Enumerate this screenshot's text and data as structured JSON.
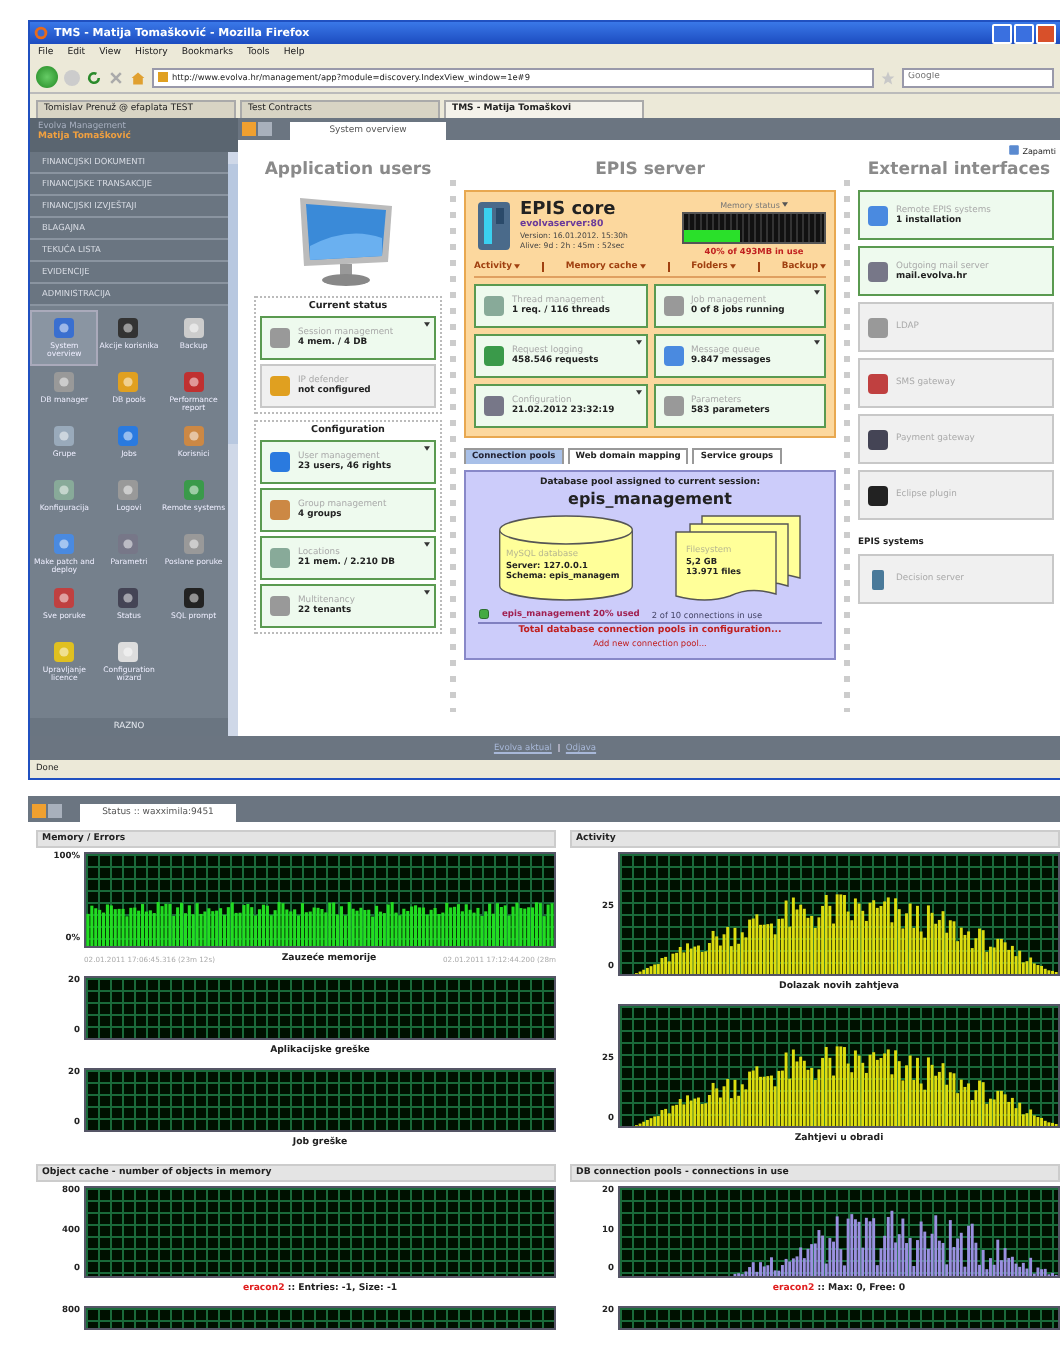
{
  "browser": {
    "title": "TMS - Matija Tomašković - Mozilla Firefox",
    "menu": [
      "File",
      "Edit",
      "View",
      "History",
      "Bookmarks",
      "Tools",
      "Help"
    ],
    "url": "http://www.evolva.hr/management/app?module=discovery.IndexView_window=1e#9",
    "search": {
      "placeholder": "Google"
    },
    "tabs": [
      {
        "label": "Tomislav Prenuž @ efaplata TEST",
        "selected": false
      },
      {
        "label": "Test Contracts",
        "selected": false
      },
      {
        "label": "TMS - Matija Tomaškovi",
        "selected": true
      }
    ],
    "status": "Done"
  },
  "app": {
    "sidebar": {
      "title": "Evolva Management",
      "user": "Matija Tomašković",
      "menu": [
        "FINANCIJSKI DOKUMENTI",
        "FINANCIJSKE TRANSAKCIJE",
        "FINANCIJSKI IZVJEŠTAJI",
        "BLAGAJNA",
        "TEKUĆA LISTA",
        "EVIDENCIJE",
        "ADMINISTRACIJA"
      ],
      "tools": [
        {
          "label": "System overview",
          "selected": true
        },
        {
          "label": "Akcije korisnika",
          "selected": false
        },
        {
          "label": "Backup",
          "selected": false
        },
        {
          "label": "DB manager",
          "selected": false
        },
        {
          "label": "DB pools",
          "selected": false
        },
        {
          "label": "Performance report",
          "selected": false
        },
        {
          "label": "Grupe",
          "selected": false
        },
        {
          "label": "Jobs",
          "selected": false
        },
        {
          "label": "Korisnici",
          "selected": false
        },
        {
          "label": "Konfiguracija",
          "selected": false
        },
        {
          "label": "Logovi",
          "selected": false
        },
        {
          "label": "Remote systems",
          "selected": false
        },
        {
          "label": "Make patch and deploy",
          "selected": false
        },
        {
          "label": "Parametri",
          "selected": false
        },
        {
          "label": "Poslane poruke",
          "selected": false
        },
        {
          "label": "Sve poruke",
          "selected": false
        },
        {
          "label": "Status",
          "selected": false
        },
        {
          "label": "SQL prompt",
          "selected": false
        },
        {
          "label": "Upravljanje licence",
          "selected": false
        },
        {
          "label": "Configuration wizard",
          "selected": false
        }
      ],
      "footer": "RAZNO"
    },
    "tabs": [
      {
        "label": "System overview",
        "selected": true
      }
    ],
    "remember": "Zapamti",
    "users": {
      "title": "Application users",
      "groups": [
        {
          "title": "Current status",
          "tiles": [
            {
              "title": "Session management",
              "value": "4 mem. / 4 DB",
              "active": true,
              "menu": true
            },
            {
              "title": "IP defender",
              "value": "not configured",
              "active": false,
              "menu": false
            }
          ]
        },
        {
          "title": "Configuration",
          "tiles": [
            {
              "title": "User management",
              "value": "23 users, 46 rights",
              "active": true,
              "menu": true
            },
            {
              "title": "Group management",
              "value": "4 groups",
              "active": true,
              "menu": false
            },
            {
              "title": "Locations",
              "value": "21 mem. / 2.210 DB",
              "active": true,
              "menu": true
            },
            {
              "title": "Multitenancy",
              "value": "22 tenants",
              "active": true,
              "menu": true
            }
          ]
        }
      ]
    },
    "server": {
      "title": "EPIS server",
      "core": {
        "title": "EPIS core",
        "host": "evolvaserver:80",
        "version": "Version: 16.01.2012. 15:30h",
        "alive": "Alive: 9d : 2h : 45m : 52sec",
        "memory_label": "Memory status",
        "memory": {
          "level": 0.4,
          "reading": "40% of 493MB in use"
        },
        "menu": [
          "Activity",
          "Memory cache",
          "Folders",
          "Backup"
        ],
        "tiles": [
          {
            "title": "Thread management",
            "value": "1 req. / 116 threads",
            "active": true,
            "menu": false
          },
          {
            "title": "Job management",
            "value": "0 of 8 jobs running",
            "active": true,
            "menu": true
          },
          {
            "title": "Request logging",
            "value": "458.546 requests",
            "active": true,
            "menu": true
          },
          {
            "title": "Message queue",
            "value": "9.847 messages",
            "active": true,
            "menu": true
          },
          {
            "title": "Configuration",
            "value": "21.02.2012 23:32:19",
            "active": true,
            "menu": true
          },
          {
            "title": "Parameters",
            "value": "583 parameters",
            "active": true,
            "menu": false
          }
        ]
      },
      "pool_tabs": [
        {
          "label": "Connection pools",
          "selected": true
        },
        {
          "label": "Web domain mapping",
          "selected": false
        },
        {
          "label": "Service groups",
          "selected": false
        }
      ],
      "pool": {
        "heading": "Database pool assigned to current session:",
        "name": "epis_management",
        "database": {
          "title": "MySQL database",
          "lines": [
            "Server: 127.0.0.1",
            "Schema: epis_managem"
          ]
        },
        "files": {
          "title": "Filesystem",
          "lines": [
            "5,2 GB",
            "13.971 files"
          ]
        },
        "usage": "epis_management 20% used",
        "connections": "2 of 10 connections in use",
        "total": "Total database connection pools in configuration...",
        "add": "Add new connection pool..."
      }
    },
    "external": {
      "title": "External interfaces",
      "tiles": [
        {
          "title": "Remote EPIS systems",
          "value": "1 installation",
          "active": true
        },
        {
          "title": "Outgoing mail server",
          "value": "mail.evolva.hr",
          "active": true
        },
        {
          "title": "LDAP",
          "active": false
        },
        {
          "title": "SMS gateway",
          "active": false
        },
        {
          "title": "Payment gateway",
          "active": false
        },
        {
          "title": "Eclipse plugin",
          "active": false
        }
      ],
      "systems_title": "EPIS systems",
      "systems": [
        {
          "title": "Decision server",
          "active": false
        }
      ]
    },
    "footer_links": [
      "Evolva aktual",
      "Odjava"
    ]
  },
  "status_page": {
    "tab": "Status :: waxximila:9451",
    "sections": [
      {
        "title": "Memory / Errors",
        "graphs": [
          {
            "kind": "memory",
            "ticks": [
              "100%",
              "0%"
            ],
            "caption": "Zauzeće memorije",
            "start": "02.01.2011 17:06:45.316 (23m 12s)",
            "end": "02.01.2011 17:12:44.200 (28m"
          },
          {
            "kind": "errors",
            "ticks": [
              "20",
              "0"
            ],
            "caption": "Aplikacijske greške"
          },
          {
            "kind": "errors",
            "ticks": [
              "20",
              "0"
            ],
            "caption": "Job greške"
          }
        ]
      },
      {
        "title": "Activity",
        "graphs": [
          {
            "kind": "load",
            "ticks": [
              "25",
              "0"
            ],
            "caption": "Dolazak novih zahtjeva"
          },
          {
            "kind": "load",
            "ticks": [
              "25",
              "0"
            ],
            "caption": "Zahtjevi u obradi"
          }
        ]
      },
      {
        "title": "Object cache - number of objects in memory",
        "graphs": [
          {
            "kind": "cache",
            "ticks": [
              "800",
              "400",
              "0"
            ],
            "source": "eracon2",
            "caption": " :: Entries: -1, Size: -1"
          },
          {
            "kind": "stub",
            "ticks": [
              "800"
            ]
          }
        ]
      },
      {
        "title": "DB connection pools - connections in use",
        "graphs": [
          {
            "kind": "pool",
            "ticks": [
              "20",
              "10",
              "0"
            ],
            "source": "eracon2",
            "caption": " :: Max: 0, Free: 0"
          },
          {
            "kind": "stub",
            "ticks": [
              "20"
            ]
          }
        ]
      }
    ]
  }
}
